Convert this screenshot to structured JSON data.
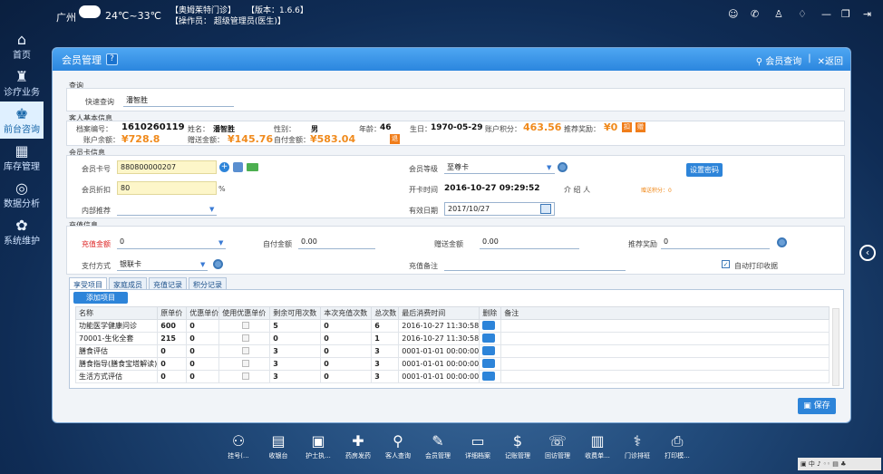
{
  "topbar": {
    "city": "广州",
    "temp": "24℃~33℃",
    "clinic": "【奥姆茱特门诊】",
    "version": "【版本：1.6.6】",
    "operator": "【操作员： 超级管理员(医生)】"
  },
  "sidebar": [
    {
      "icon": "⌂",
      "label": "首页"
    },
    {
      "icon": "♜",
      "label": "诊疗业务"
    },
    {
      "icon": "♚",
      "label": "前台咨询"
    },
    {
      "icon": "▦",
      "label": "库存管理"
    },
    {
      "icon": "◎",
      "label": "数据分析"
    },
    {
      "icon": "✿",
      "label": "系统维护"
    }
  ],
  "window": {
    "title": "会员管理",
    "help": "?",
    "search_link": "会员查询",
    "back": "返回"
  },
  "query": {
    "section": "查询",
    "label": "快速查询",
    "value": "潘智胜"
  },
  "personal": {
    "section": "客人基本信息",
    "file_label": "档案编号：",
    "file_no": "1610260119",
    "name_label": "姓名：",
    "name": "潘智胜",
    "gender_label": "性别：",
    "gender": "男",
    "age_label": "年龄：",
    "age": "46",
    "birth_label": "生日：",
    "birth": "1970-05-29",
    "points_label": "账户积分：",
    "points": "463.56",
    "reward_label": "推荐奖励：",
    "reward": "¥0",
    "btn1": "扣",
    "btn2": "赠",
    "balance_label": "账户余额：",
    "balance": "¥728.8",
    "gift_label": "赠送金额：",
    "gift": "¥145.76",
    "self_label": "自付金额：",
    "self": "¥583.04",
    "btn3": "退"
  },
  "card": {
    "section": "会员卡信息",
    "card_label": "会员卡号",
    "card_no": "880800000207",
    "discount_label": "会员折扣",
    "discount": "80",
    "pct": "%",
    "referral_label": "内部推荐",
    "referral": "",
    "level_label": "会员等级",
    "level": "至尊卡",
    "open_label": "开卡时间",
    "open_time": "2016-10-27 09:29:52",
    "introducer_label": "介 绍 人",
    "introducer": "",
    "expire_label": "有效日期",
    "expire": "2017/10/27",
    "pwd_btn": "设置密码",
    "gift_points": "赠送积分：0"
  },
  "recharge": {
    "section": "充值信息",
    "amount_label": "充值金额",
    "amount": "0",
    "self_label": "自付金额",
    "self": "0.00",
    "gift_label": "赠送金额",
    "gift": "0.00",
    "reward_label": "推荐奖励",
    "reward": "0",
    "pay_label": "支付方式",
    "pay": "银联卡",
    "note_label": "充值备注",
    "note": "",
    "print_label": "自动打印收据"
  },
  "tabs": [
    "享受项目",
    "家庭成员",
    "充值记录",
    "积分记录"
  ],
  "add_btn": "添加项目",
  "table": {
    "headers": [
      "名称",
      "原单价",
      "优惠单价",
      "使用优惠单价",
      "剩余可用次数",
      "本次充值次数",
      "总次数",
      "最后消费时间",
      "删除",
      "备注"
    ],
    "rows": [
      [
        "功能医学健康问诊",
        "600",
        "0",
        "",
        "5",
        "0",
        "6",
        "2016-10-27 11:30:58"
      ],
      [
        "70001-生化全套",
        "215",
        "0",
        "",
        "0",
        "0",
        "1",
        "2016-10-27 11:30:58"
      ],
      [
        "膳食评估",
        "0",
        "0",
        "",
        "3",
        "0",
        "3",
        "0001-01-01 00:00:00"
      ],
      [
        "膳食指导(膳食宝塔解读)",
        "0",
        "0",
        "",
        "3",
        "0",
        "3",
        "0001-01-01 00:00:00"
      ],
      [
        "生活方式评估",
        "0",
        "0",
        "",
        "3",
        "0",
        "3",
        "0001-01-01 00:00:00"
      ]
    ]
  },
  "save_btn": "保存",
  "dock": [
    {
      "icon": "⚇",
      "label": "挂号(..."
    },
    {
      "icon": "▤",
      "label": "收银台"
    },
    {
      "icon": "▣",
      "label": "护士执..."
    },
    {
      "icon": "✚",
      "label": "药房发药"
    },
    {
      "icon": "⚲",
      "label": "客人查询"
    },
    {
      "icon": "✎",
      "label": "会员管理"
    },
    {
      "icon": "▭",
      "label": "详细档案"
    },
    {
      "icon": "$",
      "label": "记账管理"
    },
    {
      "icon": "☏",
      "label": "回访管理"
    },
    {
      "icon": "▥",
      "label": "收费单..."
    },
    {
      "icon": "⚕",
      "label": "门诊排班"
    },
    {
      "icon": "⎙",
      "label": "打印模..."
    }
  ]
}
